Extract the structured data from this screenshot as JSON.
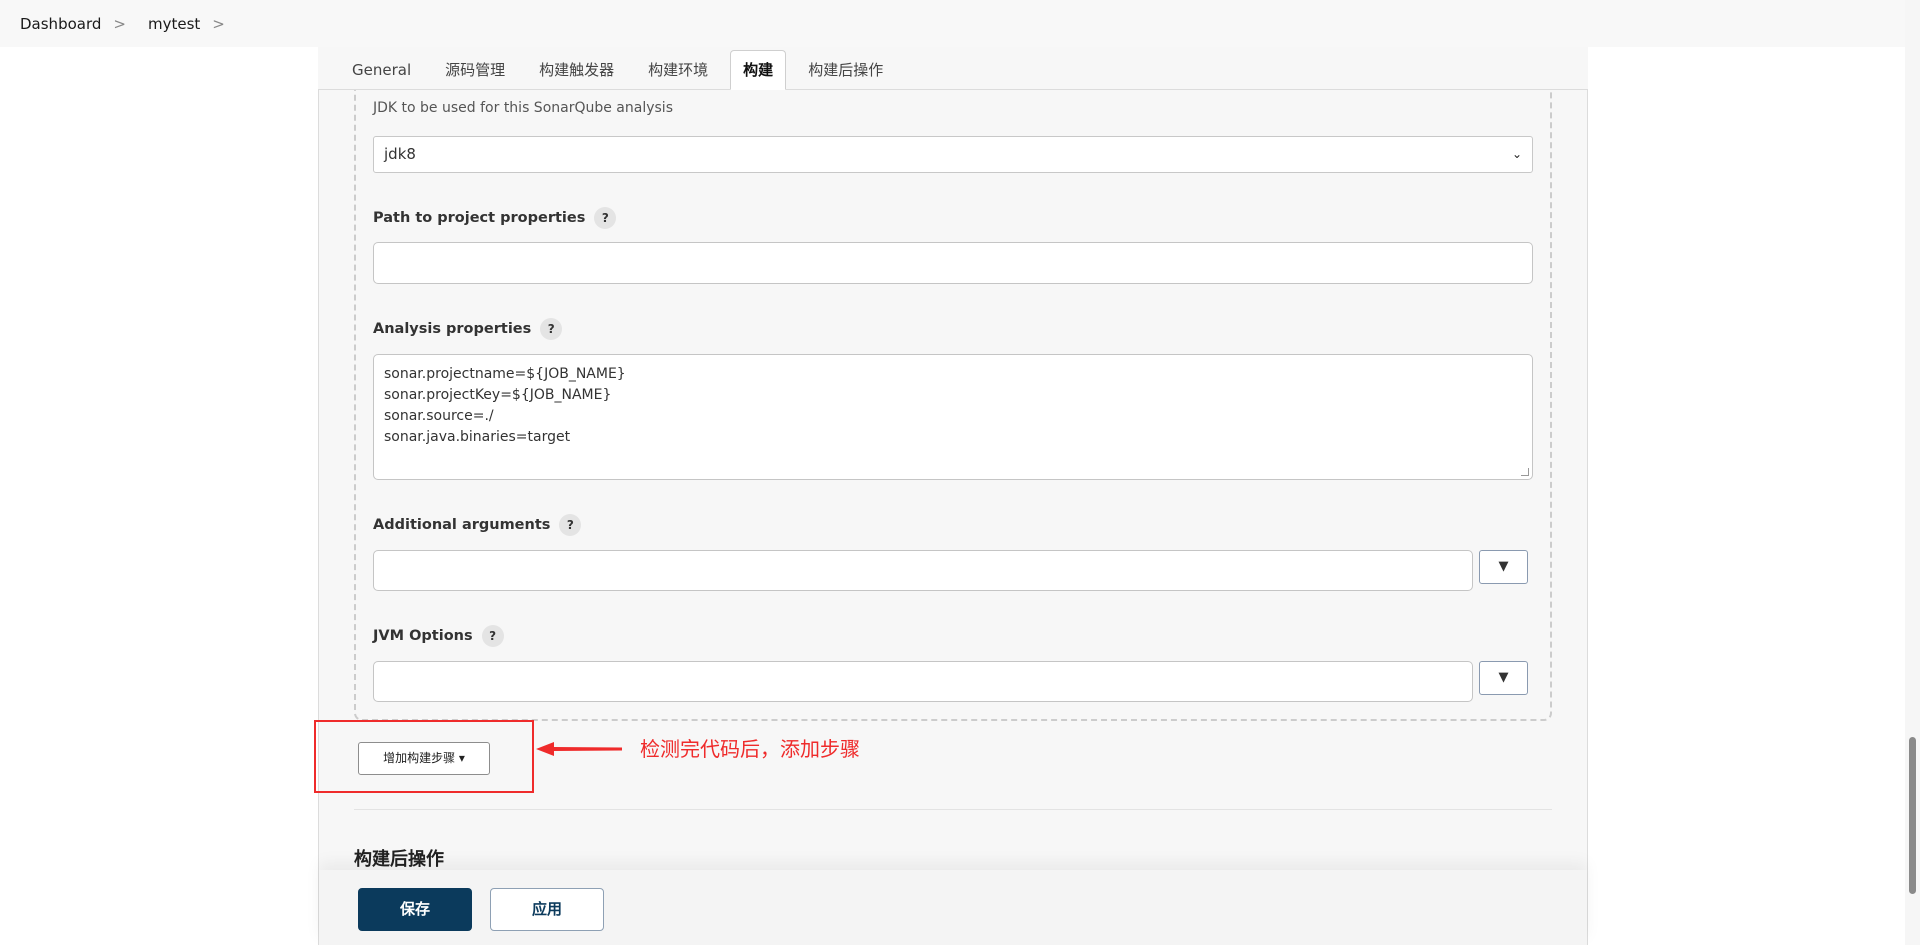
{
  "breadcrumb": {
    "items": [
      "Dashboard",
      "mytest"
    ],
    "separator": ">"
  },
  "tabs": [
    {
      "label": "General",
      "active": false
    },
    {
      "label": "源码管理",
      "active": false
    },
    {
      "label": "构建触发器",
      "active": false
    },
    {
      "label": "构建环境",
      "active": false
    },
    {
      "label": "构建",
      "active": true
    },
    {
      "label": "构建后操作",
      "active": false
    }
  ],
  "form": {
    "jdk_label": "JDK to be used for this SonarQube analysis",
    "jdk_value": "jdk8",
    "path_label": "Path to project properties",
    "path_value": "",
    "analysis_label": "Analysis properties",
    "analysis_lines": [
      "sonar.projectname=${JOB_NAME}",
      "sonar.projectKey=${JOB_NAME}",
      "sonar.source=./",
      "sonar.java.binaries=target"
    ],
    "additional_label": "Additional arguments",
    "additional_value": "",
    "jvm_label": "JVM Options",
    "jvm_value": "",
    "help_glyph": "?",
    "dropdown_glyph": "▼",
    "select_glyph": "⌄"
  },
  "add_step_label": "增加构建步骤 ▾",
  "annotation": {
    "text": "检测完代码后，添加步骤",
    "color": "#ef2b2b"
  },
  "post_build_title": "构建后操作",
  "buttons": {
    "save": "保存",
    "apply": "应用"
  },
  "colors": {
    "primary": "#0b3a5c",
    "annotation": "#ef2b2b"
  }
}
